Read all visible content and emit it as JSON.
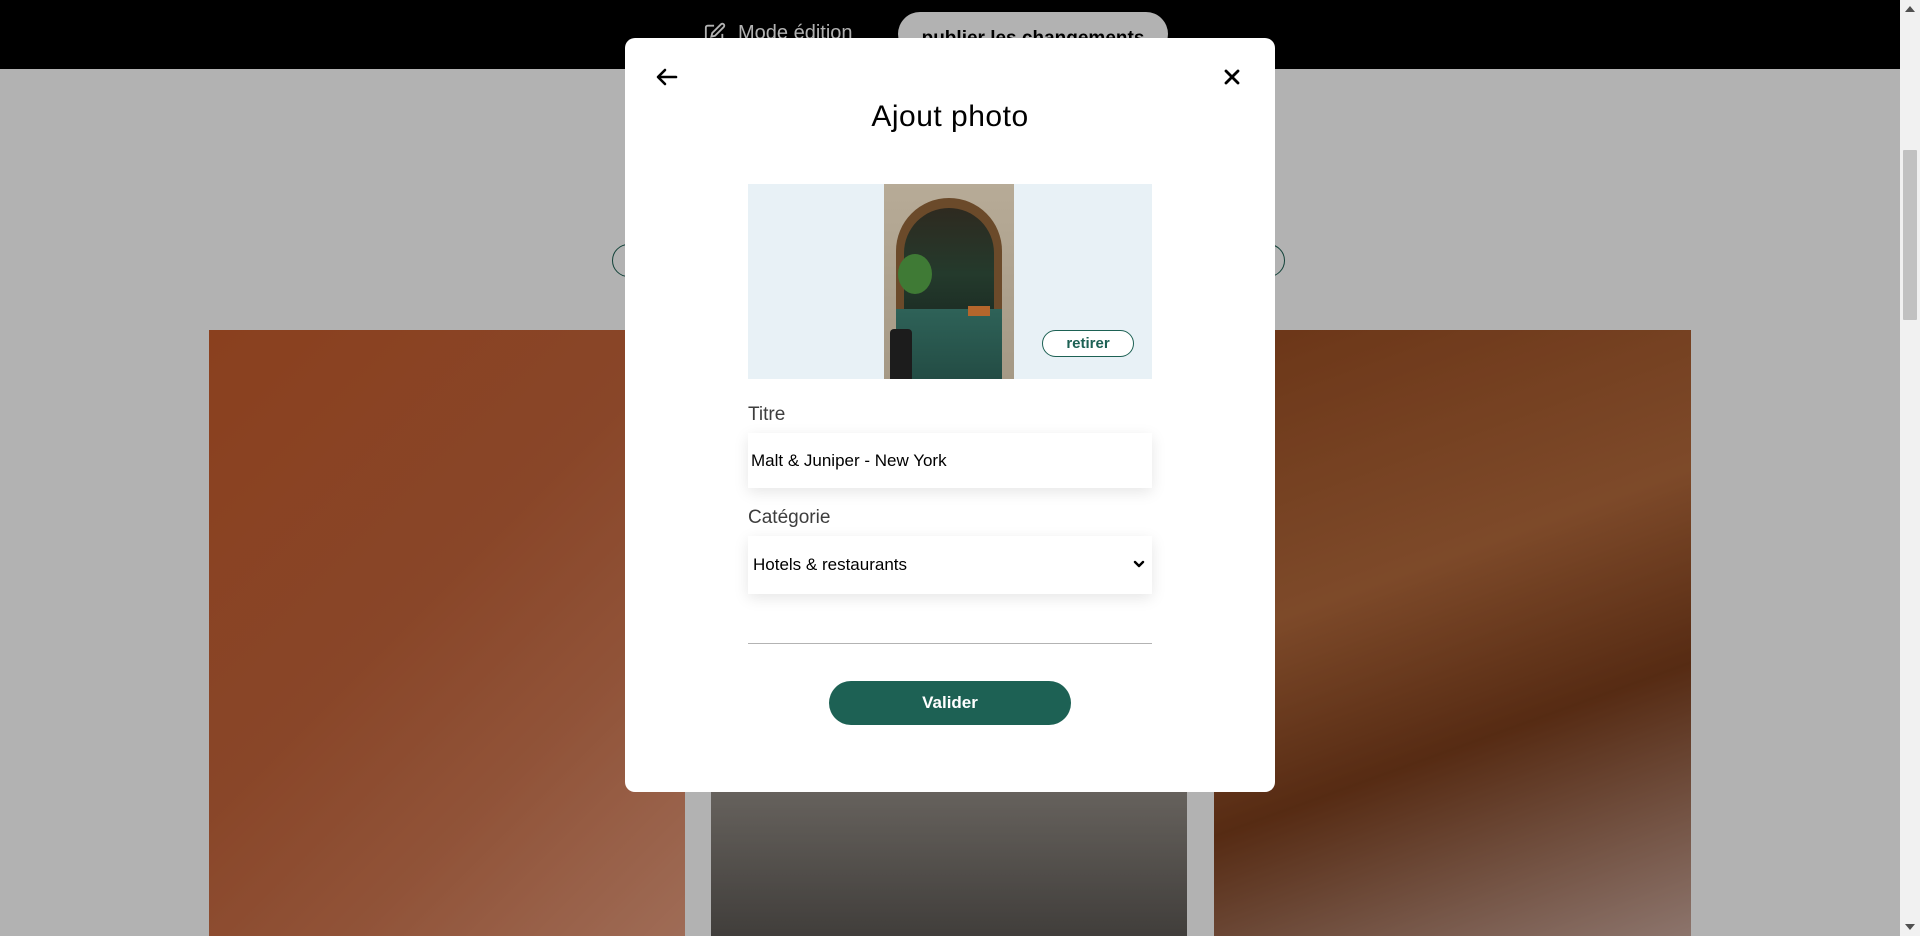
{
  "edit_bar": {
    "mode_label": "Mode édition",
    "publish_label": "publier les changements"
  },
  "modal": {
    "title": "Ajout photo",
    "remove_label": "retirer",
    "title_field": {
      "label": "Titre",
      "value": "Malt & Juniper - New York"
    },
    "category_field": {
      "label": "Catégorie",
      "selected": "Hotels & restaurants"
    },
    "submit_label": "Valider"
  },
  "colors": {
    "accent": "#1d6154",
    "overlay": "rgba(0,0,0,0.30)",
    "edit_bar": "#000000"
  },
  "icons": [
    "edit-icon",
    "arrow-left-icon",
    "close-icon",
    "chevron-down-icon"
  ]
}
